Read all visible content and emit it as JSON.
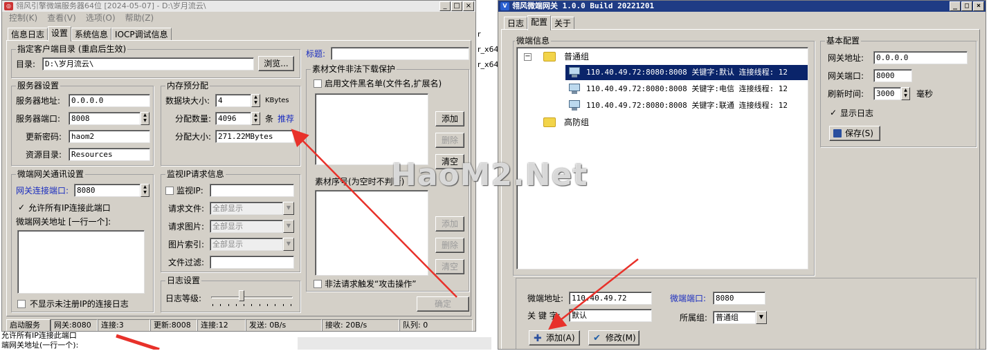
{
  "bg_fragments": {
    "r_x64_1": "r",
    "r_x64_2": "r_x64",
    "r_x64_3": "r_x64",
    "bottom_1": "允许所有IP连接此端口",
    "bottom_2": "端网关地址(一行一个):"
  },
  "left_window": {
    "title": "翎风引擎微端服务器64位 [2024-05-07] - D:\\岁月流云\\",
    "menu": [
      "控制(K)",
      "查看(V)",
      "选项(O)",
      "帮助(Z)"
    ],
    "tabs": [
      "信息日志",
      "设置",
      "系统信息",
      "IOCP调试信息"
    ],
    "client_dir": {
      "title": "指定客户端目录 (重启后生效)",
      "label": "目录:",
      "value": "D:\\岁月流云\\",
      "browse": "浏览..."
    },
    "server": {
      "title": "服务器设置",
      "addr_label": "服务器地址:",
      "addr": "0.0.0.0",
      "port_label": "服务器端口:",
      "port": "8008",
      "pwd_label": "更新密码:",
      "pwd": "haom2",
      "res_label": "资源目录:",
      "res": "Resources"
    },
    "memory": {
      "title": "内存预分配",
      "block_label": "数据块大小:",
      "block": "4",
      "block_unit": "KBytes",
      "count_label": "分配数量:",
      "count": "4096",
      "count_unit": "条",
      "recommend": "推荐",
      "size_label": "分配大小:",
      "size": "271.22MBytes"
    },
    "gateway": {
      "title": "微端网关通讯设置",
      "port_label": "网关连接端口:",
      "port": "8080",
      "allow_all": "允许所有IP连接此端口",
      "addr_label": "微端网关地址 [一行一个]:",
      "hide_log": "不显示未注册IP的连接日志"
    },
    "monitor": {
      "title": "监视IP请求信息",
      "ip_label": "监视IP:",
      "file_label": "请求文件:",
      "file_value": "全部显示",
      "img_label": "请求图片:",
      "img_value": "全部显示",
      "idx_label": "图片索引:",
      "idx_value": "全部显示",
      "filter_label": "文件过滤:"
    },
    "log": {
      "title": "日志设置",
      "level_label": "日志等级:"
    },
    "right": {
      "title_label": "标题:",
      "protect_title": "素材文件非法下载保护",
      "blacklist": "启用文件黑名单(文件名,扩展名)",
      "add1": "添加",
      "del1": "删除",
      "clear1": "清空",
      "seq_title": "素材序号(为空时不判断)",
      "add2": "添加",
      "del2": "删除",
      "clear2": "清空",
      "attack": "非法请求触发“攻击操作”",
      "ok": "确定"
    },
    "status": {
      "start": "启动服务",
      "gw": "网关:8080",
      "conn1": "连接:3",
      "upd": "更新:8008",
      "conn2": "连接:12",
      "send": "发送: 0B/s",
      "recv": "接收: 20B/s",
      "queue": "队列: 0"
    }
  },
  "right_window": {
    "title": "翎风微端网关 1.0.0 Build 20221201",
    "tabs": [
      "日志",
      "配置",
      "关于"
    ],
    "micro_title": "微端信息",
    "tree": {
      "group1": "普通组",
      "nodes": [
        "110.40.49.72:8080:8008 关键字:默认 连接线程: 12",
        "110.40.49.72:8080:8008 关键字:电信 连接线程: 12",
        "110.40.49.72:8080:8008 关键字:联通 连接线程: 12"
      ],
      "group2": "高防组"
    },
    "basic": {
      "title": "基本配置",
      "addr_label": "网关地址:",
      "addr": "0.0.0.0",
      "port_label": "网关端口:",
      "port": "8000",
      "refresh_label": "刷新时间:",
      "refresh": "3000",
      "refresh_unit": "毫秒",
      "show_log": "显示日志",
      "save": "保存(S)"
    },
    "form": {
      "addr_label": "微端地址:",
      "addr": "110.40.49.72",
      "port_label": "微端端口:",
      "port": "8080",
      "key_label": "关 键 字:",
      "key": "默认",
      "group_label": "所属组:",
      "group": "普通组",
      "add": "添加(A)",
      "edit": "修改(M)"
    }
  },
  "watermark": "HaoM2.Net",
  "colors": {
    "accent": "#0a246a",
    "label_blue": "#1a2dbf",
    "arrow": "#e8312a",
    "face": "#d4d0c8"
  }
}
